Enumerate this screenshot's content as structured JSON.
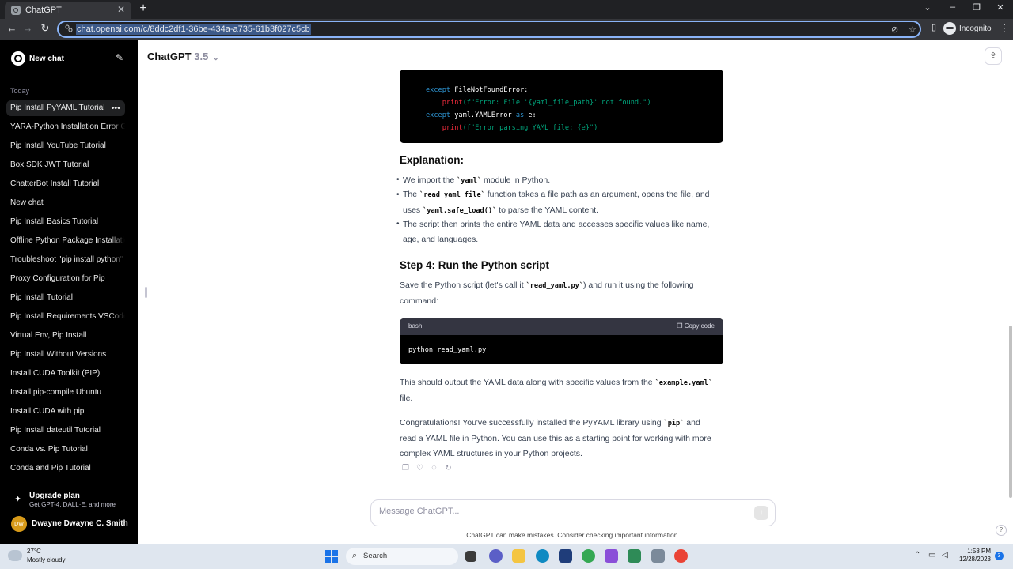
{
  "browser": {
    "tab_title": "ChatGPT",
    "url": "chat.openai.com/c/8ddc2df1-36be-434a-a735-61b3f027c5cb",
    "profile": "Incognito"
  },
  "sidebar": {
    "new_chat": "New chat",
    "group_today": "Today",
    "items": [
      {
        "label": "Pip Install PyYAML Tutorial"
      },
      {
        "label": "YARA-Python Installation Error Guide"
      },
      {
        "label": "Pip Install YouTube Tutorial"
      },
      {
        "label": "Box SDK JWT Tutorial"
      },
      {
        "label": "ChatterBot Install Tutorial"
      },
      {
        "label": "New chat"
      },
      {
        "label": "Pip Install Basics Tutorial"
      },
      {
        "label": "Offline Python Package Installation"
      },
      {
        "label": "Troubleshoot \"pip install python\""
      },
      {
        "label": "Proxy Configuration for Pip"
      },
      {
        "label": "Pip Install Tutorial"
      },
      {
        "label": "Pip Install Requirements VSCode"
      },
      {
        "label": "Virtual Env, Pip Install"
      },
      {
        "label": "Pip Install Without Versions"
      },
      {
        "label": "Install CUDA Toolkit (PIP)"
      },
      {
        "label": "Install pip-compile Ubuntu"
      },
      {
        "label": "Install CUDA with pip"
      },
      {
        "label": "Pip Install dateutil Tutorial"
      },
      {
        "label": "Conda vs. Pip Tutorial"
      },
      {
        "label": "Conda and Pip Tutorial"
      }
    ],
    "upgrade_title": "Upgrade plan",
    "upgrade_sub": "Get GPT-4, DALL·E, and more",
    "user_initials": "DW",
    "user_name": "Dwayne Dwayne C. Smith"
  },
  "main": {
    "model_name": "ChatGPT",
    "model_version": "3.5",
    "code1": {
      "l1_kw": "except",
      "l1_rest": " FileNotFoundError:",
      "l2_fn": "print",
      "l2_str": "(f\"Error: File '{yaml_file_path}' not found.\")",
      "l3_kw": "except",
      "l3_mid": " yaml.YAMLError ",
      "l3_kw2": "as",
      "l3_rest": " e:",
      "l4_fn": "print",
      "l4_str": "(f\"Error parsing YAML file: {e}\")"
    },
    "explanation_heading": "Explanation:",
    "b1_pre": "We import the ",
    "b1_code": "`yaml`",
    "b1_post": " module in Python.",
    "b2_pre": "The ",
    "b2_code1": "`read_yaml_file`",
    "b2_mid": " function takes a file path as an argument, opens the file, and uses ",
    "b2_code2": "`yaml.safe_load()`",
    "b2_post": " to parse the YAML content.",
    "b3": "The script then prints the entire YAML data and accesses specific values like name, age, and languages.",
    "step4_heading": "Step 4: Run the Python script",
    "step4_pre": "Save the Python script (let's call it ",
    "step4_code": "`read_yaml.py`",
    "step4_post": ") and run it using the following command:",
    "code2": {
      "lang": "bash",
      "copy": "Copy code",
      "line": "python read_yaml.py"
    },
    "output_pre": "This should output the YAML data along with specific values from the ",
    "output_code": "`example.yaml`",
    "output_post": " file.",
    "congrats_pre": "Congratulations! You've successfully installed the PyYAML library using ",
    "congrats_code": "`pip`",
    "congrats_post": " and read a YAML file in Python. You can use this as a starting point for working with more complex YAML structures in your Python projects.",
    "composer_placeholder": "Message ChatGPT...",
    "disclaimer": "ChatGPT can make mistakes. Consider checking important information."
  },
  "taskbar": {
    "temp": "27°C",
    "condition": "Mostly cloudy",
    "search": "Search",
    "time": "1:58 PM",
    "date": "12/28/2023",
    "notifications": "3"
  }
}
